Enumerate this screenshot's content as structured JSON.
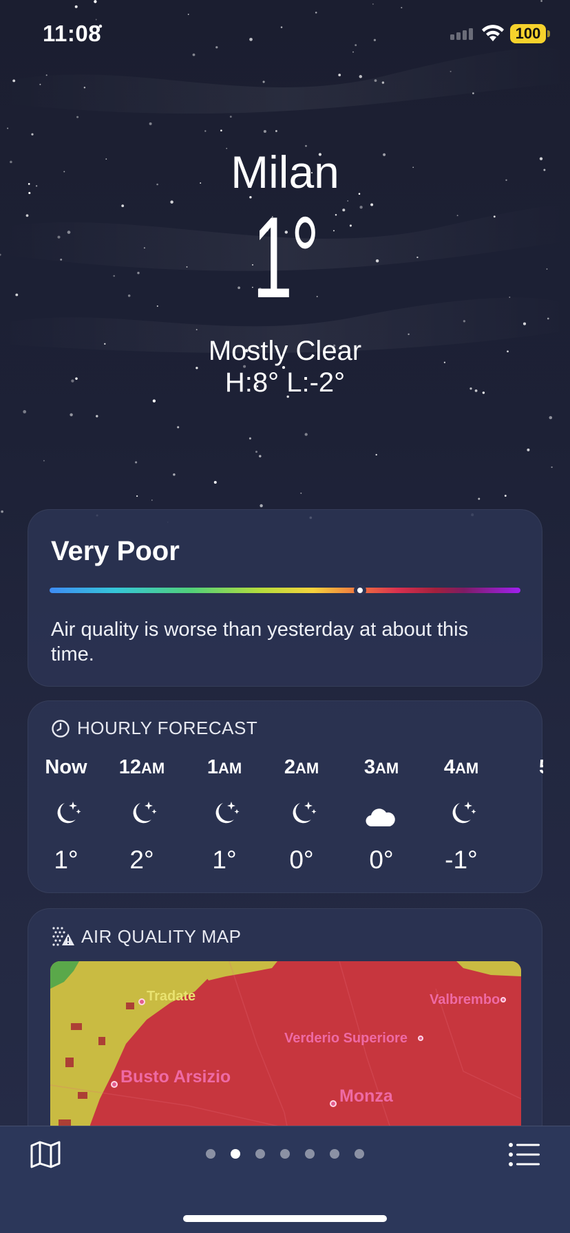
{
  "status_bar": {
    "time": "11:08",
    "battery": "100"
  },
  "location": {
    "city": "Milan",
    "temperature": "1°",
    "condition": "Mostly Clear",
    "high_low": "H:8°  L:-2°"
  },
  "air_quality": {
    "level": "Very Poor",
    "scale_position": 0.66,
    "description": "Air quality is worse than yesterday at about this time."
  },
  "hourly_forecast": {
    "title": "HOURLY FORECAST",
    "hours": [
      {
        "label": "Now",
        "suffix": "",
        "icon": "moon-stars-icon",
        "temp": "1°"
      },
      {
        "label": "12",
        "suffix": "AM",
        "icon": "moon-stars-icon",
        "temp": "2°"
      },
      {
        "label": "1",
        "suffix": "AM",
        "icon": "moon-stars-icon",
        "temp": "1°"
      },
      {
        "label": "2",
        "suffix": "AM",
        "icon": "moon-stars-icon",
        "temp": "0°"
      },
      {
        "label": "3",
        "suffix": "AM",
        "icon": "cloud-moon-icon",
        "temp": "0°"
      },
      {
        "label": "4",
        "suffix": "AM",
        "icon": "moon-stars-icon",
        "temp": "-1°"
      }
    ],
    "next_peek": "5"
  },
  "air_quality_map": {
    "title": "AIR QUALITY MAP",
    "places": [
      {
        "name": "Tradate"
      },
      {
        "name": "Valbrembo"
      },
      {
        "name": "Verderio Superiore"
      },
      {
        "name": "Busto Arsizio"
      },
      {
        "name": "Monza"
      }
    ]
  },
  "pager": {
    "count": 7,
    "active_index": 1
  },
  "colors": {
    "background": "#1d2136",
    "card": "#2c3454",
    "map_red": "#c7363e",
    "map_yellow": "#c9bb42",
    "map_green": "#5aa84a",
    "label_pink": "#ee6aa4",
    "battery": "#f6d22c"
  },
  "icons": {
    "bottom_left": "map-icon",
    "bottom_right": "list-icon",
    "hourly_header": "clock-icon",
    "map_header": "air-quality-icon"
  }
}
